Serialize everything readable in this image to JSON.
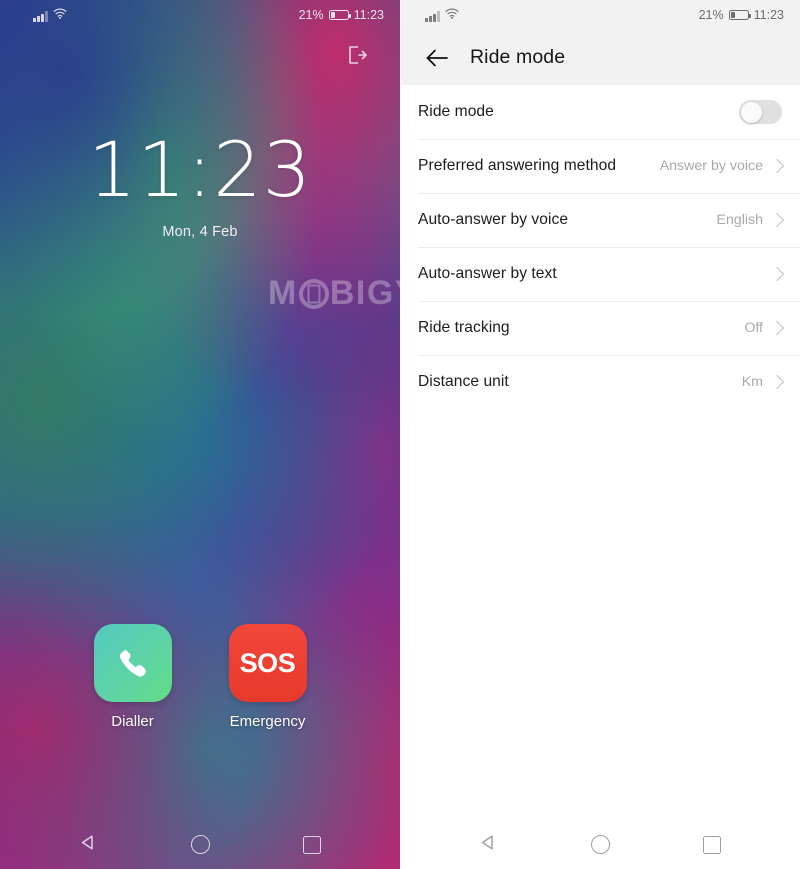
{
  "watermark": {
    "part1": "M",
    "part2": "BIGYAAN"
  },
  "lockscreen": {
    "status_bar": {
      "battery_percent": "21%",
      "time": "11:23",
      "signal_icon": "signal-bars-icon",
      "wifi_icon": "wifi-icon",
      "battery_icon": "battery-icon"
    },
    "logout_icon": "logout-icon",
    "clock": {
      "time": "11:23",
      "date": "Mon, 4 Feb"
    },
    "dock": [
      {
        "label": "Dialler",
        "icon": "phone-handset-icon",
        "color": "#5ed3a6"
      },
      {
        "label": "Emergency",
        "icon": "sos-icon",
        "text": "SOS",
        "color": "#e8392c"
      }
    ],
    "navbar": [
      {
        "name": "back",
        "icon": "back-triangle-icon"
      },
      {
        "name": "home",
        "icon": "home-circle-icon"
      },
      {
        "name": "recents",
        "icon": "recents-square-icon"
      }
    ]
  },
  "settings": {
    "status_bar": {
      "battery_percent": "21%",
      "time": "11:23",
      "signal_icon": "signal-bars-icon",
      "wifi_icon": "wifi-icon",
      "battery_icon": "battery-icon"
    },
    "appbar": {
      "title": "Ride mode",
      "back_icon": "back-arrow-icon"
    },
    "rows": [
      {
        "label": "Ride mode",
        "control": "toggle",
        "toggle_on": false
      },
      {
        "label": "Preferred answering method",
        "control": "chevron",
        "value": "Answer by voice"
      },
      {
        "label": "Auto-answer by voice",
        "control": "chevron",
        "value": "English"
      },
      {
        "label": "Auto-answer by text",
        "control": "chevron",
        "value": ""
      },
      {
        "label": "Ride tracking",
        "control": "chevron",
        "value": "Off"
      },
      {
        "label": "Distance unit",
        "control": "chevron",
        "value": "Km"
      }
    ],
    "navbar": [
      {
        "name": "back",
        "icon": "back-triangle-icon"
      },
      {
        "name": "home",
        "icon": "home-circle-icon"
      },
      {
        "name": "recents",
        "icon": "recents-square-icon"
      }
    ]
  }
}
